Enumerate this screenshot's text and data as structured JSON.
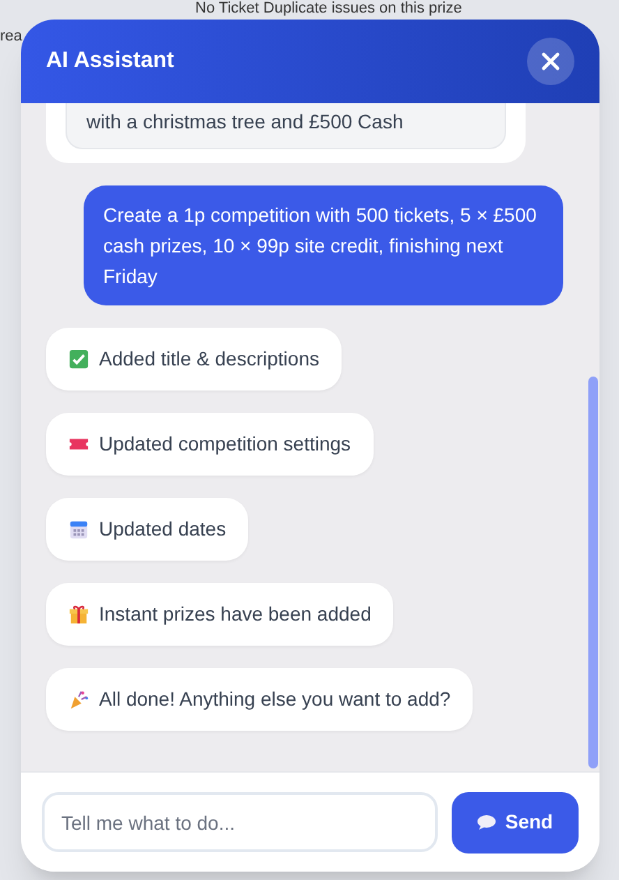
{
  "background": {
    "top_text": "No Ticket Duplicate issues on this prize",
    "side_text": "rea"
  },
  "window": {
    "title": "AI Assistant"
  },
  "messages": [
    {
      "kind": "quote",
      "text": "with a christmas tree and £500 Cash"
    },
    {
      "kind": "request",
      "text": "Create a 1p competition with 500 tickets, 5 × £500 cash prizes, 10 × 99p site credit, finishing next Friday"
    },
    {
      "kind": "check",
      "text": "Added title & descriptions"
    },
    {
      "kind": "ticket",
      "text": "Updated competition settings"
    },
    {
      "kind": "calendar",
      "text": "Updated dates"
    },
    {
      "kind": "gift",
      "text": "Instant prizes have been added"
    },
    {
      "kind": "party",
      "text": "All done! Anything else you want to add?"
    }
  ],
  "composer": {
    "placeholder": "Tell me what to do...",
    "button": "Send"
  }
}
